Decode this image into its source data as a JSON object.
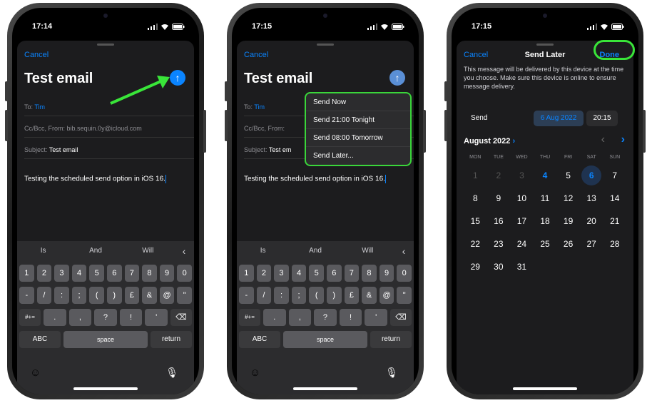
{
  "phones": [
    {
      "time": "17:14"
    },
    {
      "time": "17:15"
    },
    {
      "time": "17:15"
    }
  ],
  "compose": {
    "cancel": "Cancel",
    "title": "Test email",
    "to_label": "To:",
    "to_value": "Tim",
    "ccbcc_label": "Cc/Bcc, From:",
    "ccbcc_value": "bib.sequin.0y@icloud.com",
    "subject_label": "Subject:",
    "subject_value": "Test email",
    "subject_value_clipped": "Test em",
    "body": "Testing the scheduled send option in iOS 16."
  },
  "keyboard": {
    "suggestions": [
      "Is",
      "And",
      "Will"
    ],
    "row1": [
      "1",
      "2",
      "3",
      "4",
      "5",
      "6",
      "7",
      "8",
      "9",
      "0"
    ],
    "row2": [
      "-",
      "/",
      ":",
      ";",
      "(",
      ")",
      "£",
      "&",
      "@",
      "\""
    ],
    "row3_left": "#+=",
    "row3": [
      ".",
      ",",
      "?",
      "!",
      "'"
    ],
    "abc": "ABC",
    "space": "space",
    "return": "return"
  },
  "send_menu": [
    "Send Now",
    "Send 21:00 Tonight",
    "Send 08:00 Tomorrow",
    "Send Later..."
  ],
  "send_later": {
    "cancel": "Cancel",
    "title": "Send Later",
    "done": "Done",
    "info": "This message will be delivered by this device at the time you choose. Make sure this device is online to ensure message delivery.",
    "send_label": "Send",
    "date": "6 Aug 2022",
    "time": "20:15",
    "month": "August 2022",
    "weekdays": [
      "MON",
      "TUE",
      "WED",
      "THU",
      "FRI",
      "SAT",
      "SUN"
    ],
    "weeks": [
      [
        "1",
        "2",
        "3",
        "4",
        "5",
        "6",
        "7"
      ],
      [
        "8",
        "9",
        "10",
        "11",
        "12",
        "13",
        "14"
      ],
      [
        "15",
        "16",
        "17",
        "18",
        "19",
        "20",
        "21"
      ],
      [
        "22",
        "23",
        "24",
        "25",
        "26",
        "27",
        "28"
      ],
      [
        "29",
        "30",
        "31",
        "",
        "",
        "",
        ""
      ]
    ],
    "disabled_days": [
      "1",
      "2",
      "3"
    ],
    "today": "4",
    "selected": "6"
  },
  "colors": {
    "accent": "#0a84ff",
    "highlight": "#39e539",
    "sheet": "#1c1c1e",
    "keyboard": "#2c2c2e"
  }
}
